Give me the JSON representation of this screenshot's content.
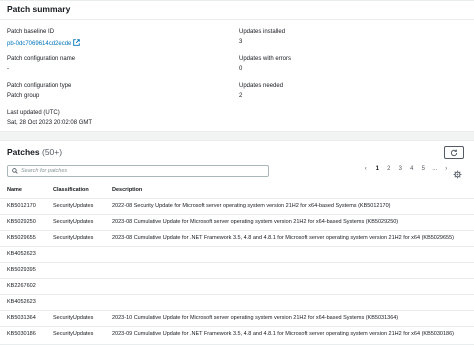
{
  "summary": {
    "title": "Patch summary",
    "patch_baseline_label": "Patch baseline ID",
    "patch_baseline_value": "pb-0dc7069614cd2ecde",
    "patch_config_name_label": "Patch configuration name",
    "patch_config_name_value": "-",
    "patch_config_type_label": "Patch configuration type",
    "patch_config_type_value": "Patch group",
    "last_updated_label": "Last updated (UTC)",
    "last_updated_value": "Sat, 28 Oct 2023 20:02:08 GMT",
    "updates_installed_label": "Updates installed",
    "updates_installed_value": "3",
    "updates_errors_label": "Updates with errors",
    "updates_errors_value": "0",
    "updates_needed_label": "Updates needed",
    "updates_needed_value": "2"
  },
  "patches": {
    "title": "Patches",
    "count": "(50+)",
    "search_placeholder": "Search for patches",
    "pages": [
      "1",
      "2",
      "3",
      "4",
      "5",
      "..."
    ],
    "columns": {
      "name": "Name",
      "classification": "Classification",
      "description": "Description"
    },
    "rows": [
      {
        "name": "KB5012170",
        "classification": "SecurityUpdates",
        "description": "2022-08 Security Update for Microsoft server operating system version 21H2 for x64-based Systems (KB5012170)"
      },
      {
        "name": "KB5029250",
        "classification": "SecurityUpdates",
        "description": "2023-08 Cumulative Update for Microsoft server operating system version 21H2 for x64-based Systems (KB5029250)"
      },
      {
        "name": "KB5029655",
        "classification": "SecurityUpdates",
        "description": "2023-08 Cumulative Update for .NET Framework 3.5, 4.8 and 4.8.1 for Microsoft server operating system version 21H2 for x64 (KB5029655)"
      },
      {
        "name": "KB4052623",
        "classification": "",
        "description": ""
      },
      {
        "name": "KB5029395",
        "classification": "",
        "description": ""
      },
      {
        "name": "KB2267602",
        "classification": "",
        "description": ""
      },
      {
        "name": "KB4052623",
        "classification": "",
        "description": ""
      },
      {
        "name": "KB5031364",
        "classification": "SecurityUpdates",
        "description": "2023-10 Cumulative Update for Microsoft server operating system version 21H2 for x64-based Systems (KB5031364)"
      },
      {
        "name": "KB5030186",
        "classification": "SecurityUpdates",
        "description": "2023-09 Cumulative Update for .NET Framework 3.5, 4.8 and 4.8.1 for Microsoft server operating system version 21H2 for x64 (KB5030186)"
      }
    ]
  }
}
